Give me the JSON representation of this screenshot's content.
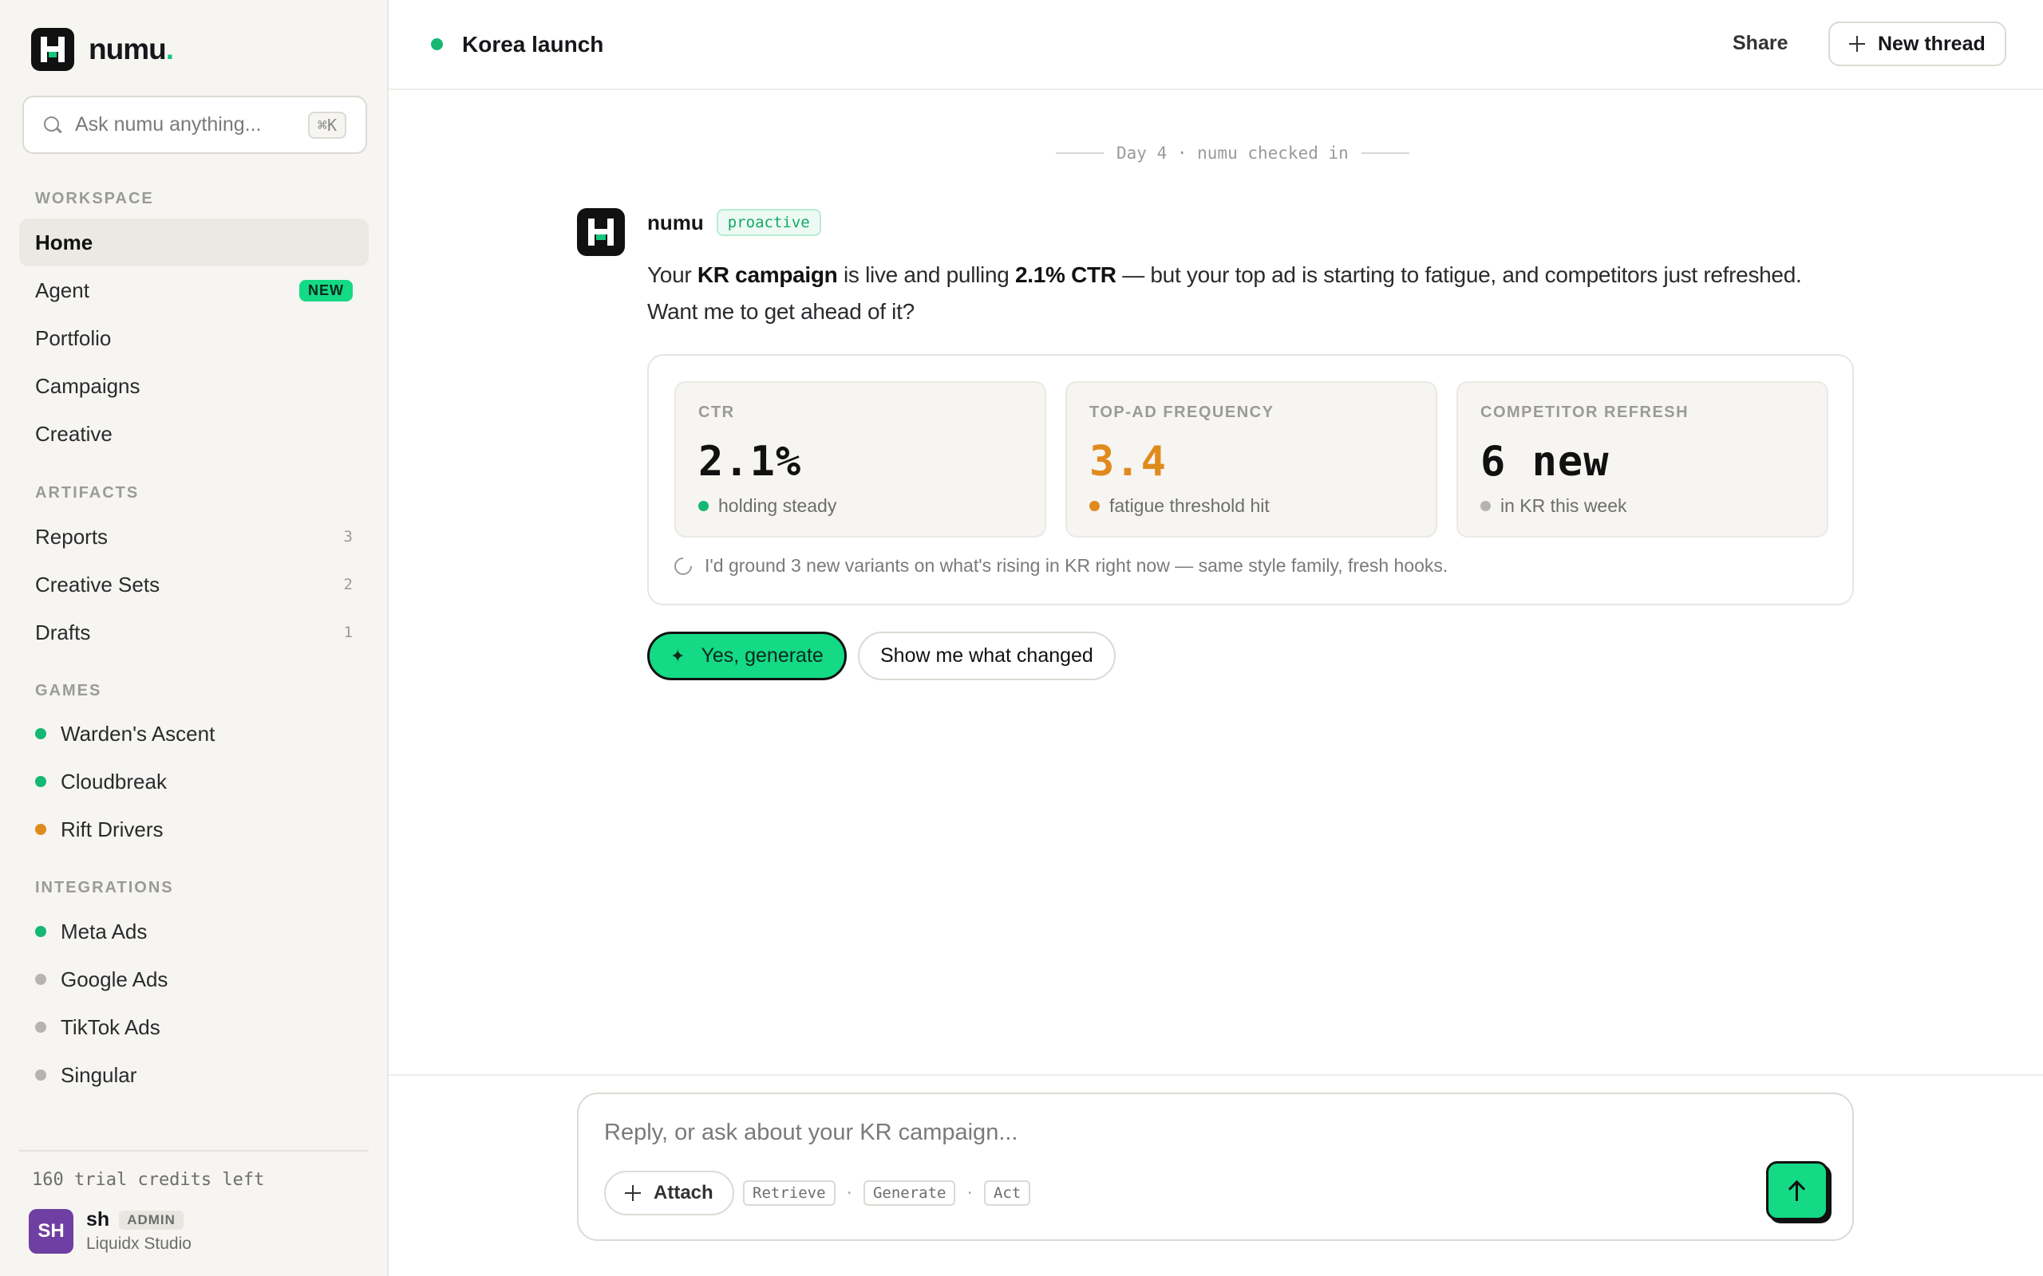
{
  "brand": {
    "name": "numu",
    "dot": ".",
    "accent_color": "#14c77e"
  },
  "search": {
    "placeholder": "Ask numu anything...",
    "shortcut": "⌘K"
  },
  "sidebar": {
    "workspace_label": "WORKSPACE",
    "workspace": [
      {
        "label": "Home",
        "active": true
      },
      {
        "label": "Agent",
        "badge": "NEW"
      },
      {
        "label": "Portfolio"
      },
      {
        "label": "Campaigns"
      },
      {
        "label": "Creative"
      }
    ],
    "artifacts_label": "ARTIFACTS",
    "artifacts": [
      {
        "label": "Reports",
        "count": "3"
      },
      {
        "label": "Creative Sets",
        "count": "2"
      },
      {
        "label": "Drafts",
        "count": "1"
      }
    ],
    "games_label": "GAMES",
    "games": [
      {
        "label": "Warden's Ascent",
        "status_color": "#14b873"
      },
      {
        "label": "Cloudbreak",
        "status_color": "#14b873"
      },
      {
        "label": "Rift Drivers",
        "status_color": "#e08a1e"
      }
    ],
    "integrations_label": "INTEGRATIONS",
    "integrations": [
      {
        "label": "Meta Ads",
        "status_color": "#14b873"
      },
      {
        "label": "Google Ads",
        "status_color": "#b5b4b0"
      },
      {
        "label": "TikTok Ads",
        "status_color": "#b5b4b0"
      },
      {
        "label": "Singular",
        "status_color": "#b5b4b0"
      }
    ],
    "credits": "160 trial credits left",
    "user": {
      "initials": "SH",
      "name": "sh",
      "role": "ADMIN",
      "org": "Liquidx Studio"
    }
  },
  "header": {
    "title": "Korea launch",
    "share_label": "Share",
    "new_thread_label": "New thread"
  },
  "thread": {
    "day_separator": "Day 4 · numu checked in",
    "message": {
      "author": "numu",
      "tag": "proactive",
      "t1": "Your ",
      "b1": "KR campaign",
      "t2": " is live and pulling ",
      "b2": "2.1% CTR",
      "t3": " — but your top ad is starting to fatigue, and competitors just refreshed. Want me to get ahead of it?"
    },
    "stats": [
      {
        "label": "CTR",
        "value": "2.1%",
        "note": "holding steady",
        "value_color": "#111111",
        "dot_color": "#14b873"
      },
      {
        "label": "TOP-AD FREQUENCY",
        "value": "3.4",
        "note": "fatigue threshold hit",
        "value_color": "#e08a1e",
        "dot_color": "#e08a1e"
      },
      {
        "label": "COMPETITOR REFRESH",
        "value": "6 new",
        "note": "in KR this week",
        "value_color": "#111111",
        "dot_color": "#b5b4b0"
      }
    ],
    "suggestion": "I'd ground 3 new variants on what's rising in KR right now — same style family, fresh hooks.",
    "actions": {
      "primary": "Yes, generate",
      "secondary": "Show me what changed"
    }
  },
  "composer": {
    "placeholder": "Reply, or ask about your KR campaign...",
    "attach_label": "Attach",
    "modes": [
      "Retrieve",
      "Generate",
      "Act"
    ]
  }
}
